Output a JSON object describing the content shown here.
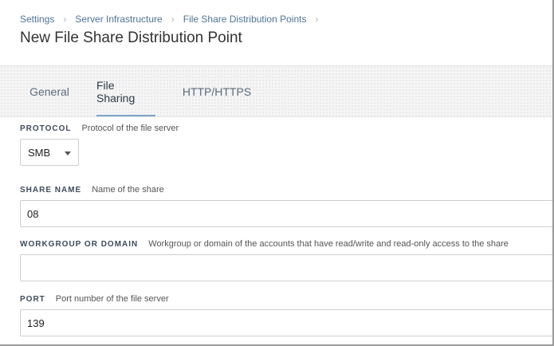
{
  "breadcrumb": [
    {
      "label": "Settings"
    },
    {
      "label": "Server Infrastructure"
    },
    {
      "label": "File Share Distribution Points"
    }
  ],
  "breadcrumb_separator": "›",
  "page_title": "New File Share Distribution Point",
  "tabs": [
    {
      "label": "General",
      "active": false
    },
    {
      "label": "File Sharing",
      "active": true
    },
    {
      "label": "HTTP/HTTPS",
      "active": false
    }
  ],
  "fields": {
    "protocol": {
      "label": "PROTOCOL",
      "description": "Protocol of the file server",
      "value": "SMB"
    },
    "share_name": {
      "label": "SHARE NAME",
      "description": "Name of the share",
      "value": "08"
    },
    "workgroup": {
      "label": "WORKGROUP OR DOMAIN",
      "description": "Workgroup or domain of the accounts that have read/write and read-only access to the share",
      "value": ""
    },
    "port": {
      "label": "PORT",
      "description": "Port number of the file server",
      "value": "139"
    }
  },
  "icons": {
    "select_caret": "caret-down-icon"
  },
  "colors": {
    "accent": "#7fa2c6",
    "link": "#4f7399"
  }
}
